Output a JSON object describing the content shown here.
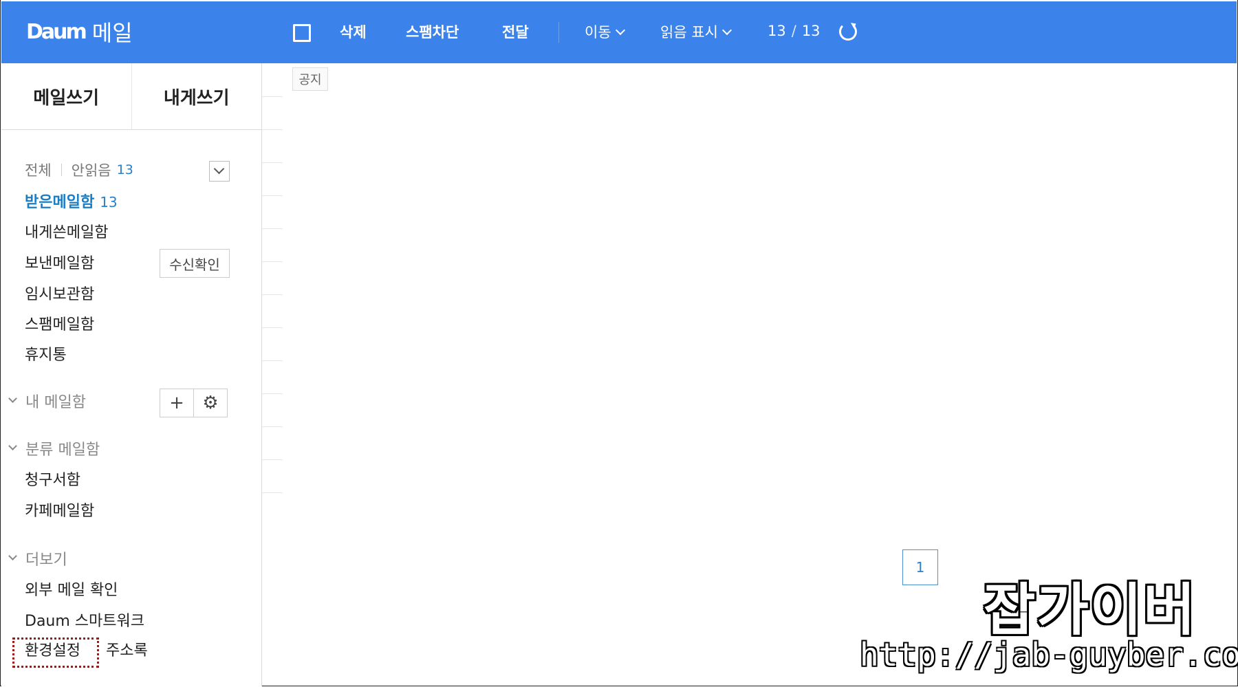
{
  "header": {
    "logo_brand": "Daum",
    "logo_service": "메일",
    "toolbar": {
      "delete": "삭제",
      "block_spam": "스팸차단",
      "forward": "전달",
      "move": "이동",
      "mark_read": "읽음 표시",
      "count_current": "13",
      "count_separator": "/",
      "count_total": "13"
    },
    "icons": {
      "select_all": "checkbox-icon",
      "refresh": "refresh-icon"
    },
    "colors": {
      "bar": "#3b82ea"
    }
  },
  "sidebar": {
    "compose": "메일쓰기",
    "write_to_me": "내게쓰기",
    "filter_all": "전체",
    "filter_unread": "안읽음",
    "filter_unread_count": "13",
    "folders": [
      {
        "label": "받은메일함",
        "count": "13"
      },
      {
        "label": "내게쓴메일함"
      },
      {
        "label": "보낸메일함"
      },
      {
        "label": "임시보관함"
      },
      {
        "label": "스팸메일함"
      },
      {
        "label": "휴지통"
      }
    ],
    "receipt_button": "수신확인",
    "my_mailbox_section": "내 메일함",
    "category_section": "분류 메일함",
    "category_folders": [
      {
        "label": "청구서함"
      },
      {
        "label": "카페메일함"
      }
    ],
    "more_section": "더보기",
    "more_items": [
      {
        "label": "외부 메일 확인"
      },
      {
        "label": "Daum 스마트워크"
      }
    ],
    "settings": "환경설정",
    "address_book": "주소록"
  },
  "main": {
    "notice_tag": "공지",
    "page_number": "1"
  },
  "watermark": {
    "title": "잡가이버",
    "url": "http://jab-guyber.com"
  }
}
